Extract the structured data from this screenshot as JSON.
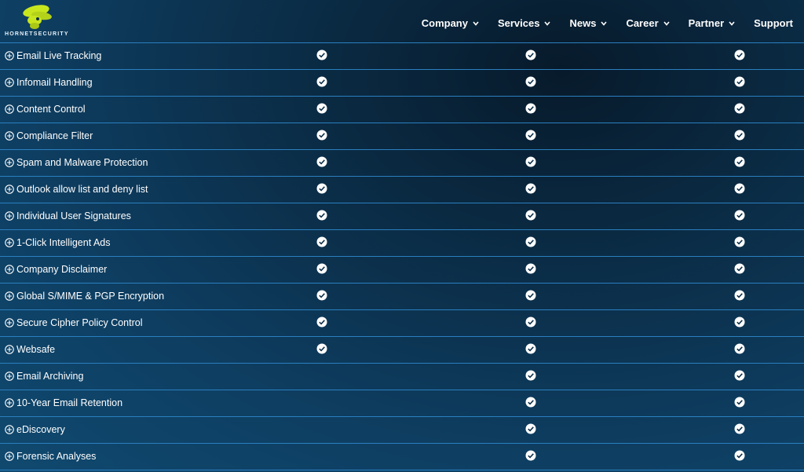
{
  "logo": {
    "text": "HORNETSECURITY",
    "icon": "hornet-logo-icon",
    "color": "#c8e61e"
  },
  "nav": [
    {
      "label": "Company",
      "dropdown": true
    },
    {
      "label": "Services",
      "dropdown": true
    },
    {
      "label": "News",
      "dropdown": true
    },
    {
      "label": "Career",
      "dropdown": true
    },
    {
      "label": "Partner",
      "dropdown": true
    },
    {
      "label": "Support",
      "dropdown": false
    }
  ],
  "features": [
    {
      "label": "Email Live Tracking",
      "checks": [
        true,
        true,
        true
      ]
    },
    {
      "label": "Infomail Handling",
      "checks": [
        true,
        true,
        true
      ]
    },
    {
      "label": "Content Control",
      "checks": [
        true,
        true,
        true
      ]
    },
    {
      "label": "Compliance Filter",
      "checks": [
        true,
        true,
        true
      ]
    },
    {
      "label": "Spam and Malware Protection",
      "checks": [
        true,
        true,
        true
      ]
    },
    {
      "label": "Outlook allow list and deny list",
      "checks": [
        true,
        true,
        true
      ]
    },
    {
      "label": "Individual User Signatures",
      "checks": [
        true,
        true,
        true
      ]
    },
    {
      "label": "1-Click Intelligent Ads",
      "checks": [
        true,
        true,
        true
      ]
    },
    {
      "label": "Company Disclaimer",
      "checks": [
        true,
        true,
        true
      ]
    },
    {
      "label": "Global S/MIME & PGP Encryption",
      "checks": [
        true,
        true,
        true
      ]
    },
    {
      "label": "Secure Cipher Policy Control",
      "checks": [
        true,
        true,
        true
      ]
    },
    {
      "label": "Websafe",
      "checks": [
        true,
        true,
        true
      ]
    },
    {
      "label": "Email Archiving",
      "checks": [
        false,
        true,
        true
      ]
    },
    {
      "label": "10-Year Email Retention",
      "checks": [
        false,
        true,
        true
      ]
    },
    {
      "label": "eDiscovery",
      "checks": [
        false,
        true,
        true
      ]
    },
    {
      "label": "Forensic Analyses",
      "checks": [
        false,
        true,
        true
      ]
    }
  ],
  "colors": {
    "divider": "#2a7fc0",
    "background": "#0e3f63",
    "text": "#ffffff"
  }
}
